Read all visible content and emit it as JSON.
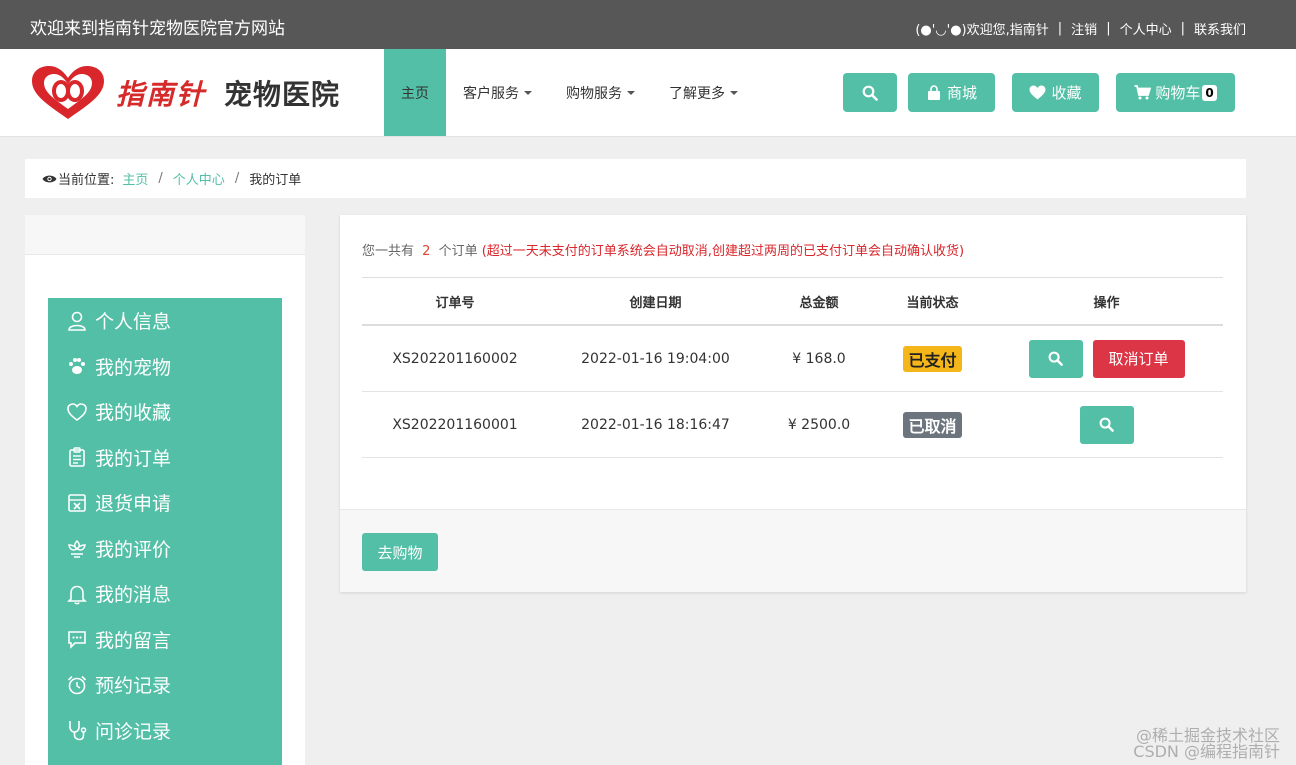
{
  "topbar": {
    "welcome": "欢迎来到指南针宠物医院官方网站",
    "greeting": "(●'◡'●)欢迎您,指南针",
    "logout": "注销",
    "personal_center": "个人中心",
    "contact": "联系我们",
    "separator": "|"
  },
  "header": {
    "logo_text": "指南针",
    "logo_sub": "宠物医院",
    "nav": [
      {
        "label": "主页"
      },
      {
        "label": "客户服务"
      },
      {
        "label": "购物服务"
      },
      {
        "label": "了解更多"
      }
    ],
    "mall_label": "商城",
    "favorites_label": "收藏",
    "cart_label": "购物车",
    "cart_count": "0"
  },
  "breadcrumb": {
    "prefix": "当前位置:",
    "home": "主页",
    "center": "个人中心",
    "current": "我的订单",
    "separator": "/"
  },
  "sidebar": {
    "items": [
      {
        "label": "个人信息",
        "icon": "user-icon"
      },
      {
        "label": "我的宠物",
        "icon": "paw-icon"
      },
      {
        "label": "我的收藏",
        "icon": "heart-icon"
      },
      {
        "label": "我的订单",
        "icon": "clipboard-icon"
      },
      {
        "label": "退货申请",
        "icon": "return-box-icon"
      },
      {
        "label": "我的评价",
        "icon": "flower-icon"
      },
      {
        "label": "我的消息",
        "icon": "bell-icon"
      },
      {
        "label": "我的留言",
        "icon": "chat-icon"
      },
      {
        "label": "预约记录",
        "icon": "alarm-clock-icon"
      },
      {
        "label": "问诊记录",
        "icon": "stethoscope-icon"
      }
    ]
  },
  "orders": {
    "summary_prefix": "您一共有",
    "count": "2",
    "summary_suffix": "个订单",
    "note": "(超过一天未支付的订单系统会自动取消,创建超过两周的已支付订单会自动确认收货)",
    "headers": {
      "order_no": "订单号",
      "created": "创建日期",
      "total": "总金额",
      "status": "当前状态",
      "actions": "操作"
    },
    "rows": [
      {
        "order_no": "XS202201160002",
        "created": "2022-01-16 19:04:00",
        "total": "¥ 168.0",
        "status": "已支付",
        "cancel_label": "取消订单"
      },
      {
        "order_no": "XS202201160001",
        "created": "2022-01-16 18:16:47",
        "total": "¥ 2500.0",
        "status": "已取消"
      }
    ],
    "go_shopping": "去购物"
  },
  "watermarks": {
    "line1": "@稀土掘金技术社区",
    "line2": "CSDN @编程指南针"
  },
  "colors": {
    "accent": "#52bfa6",
    "topbar": "#575757",
    "danger": "#dc3545",
    "paid": "#f4b619",
    "cancelled": "#6c757d"
  }
}
